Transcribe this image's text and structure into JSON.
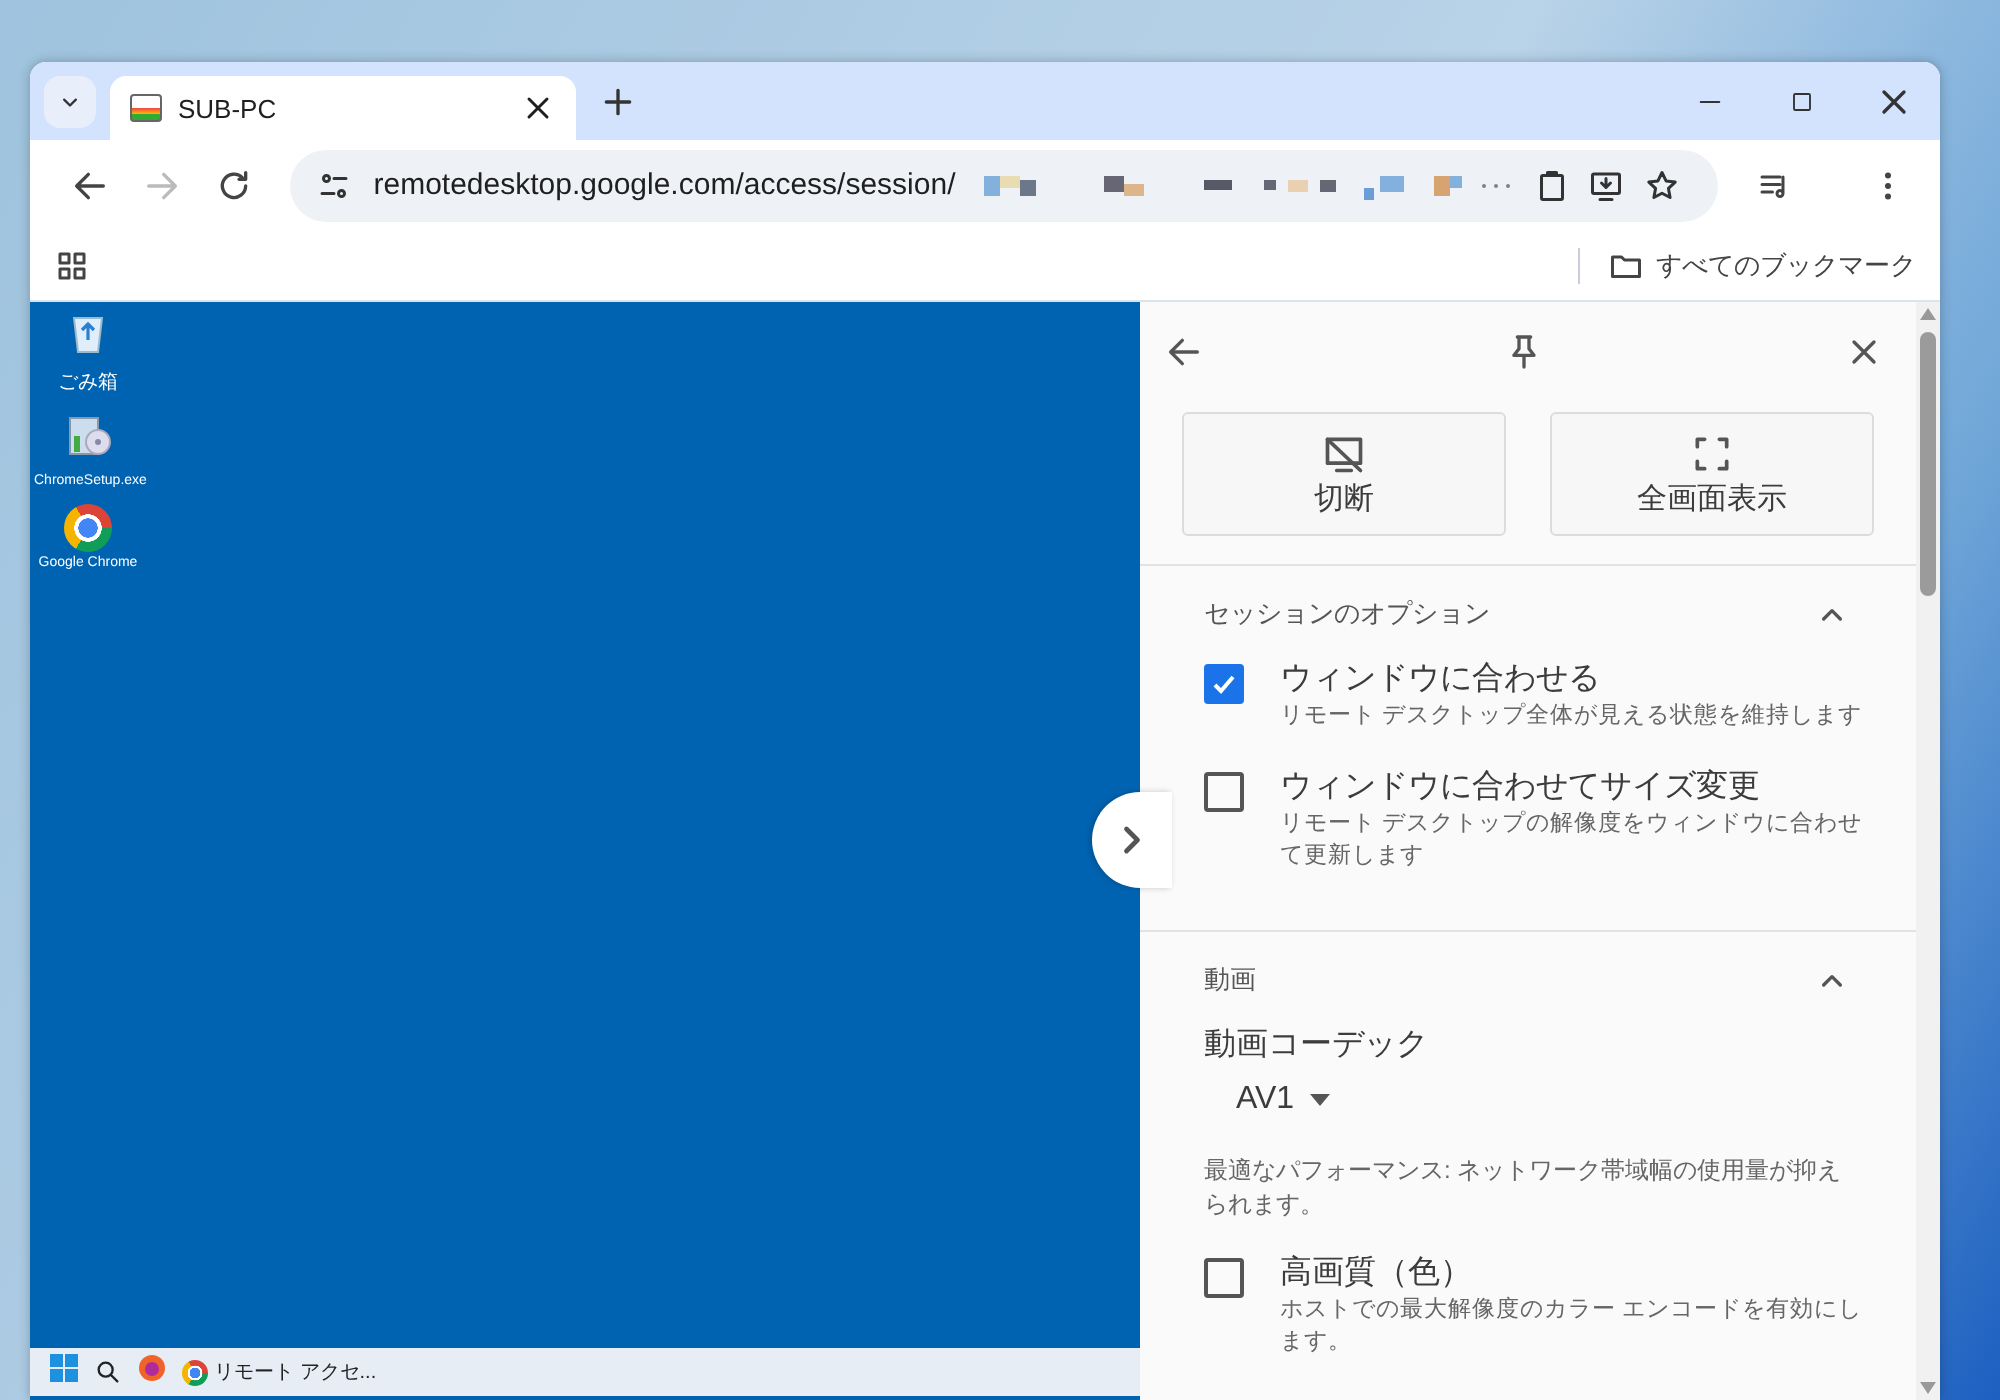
{
  "tab_strip": {
    "tab": {
      "title": "SUB-PC",
      "selected": true
    }
  },
  "address_bar": {
    "url": "remotedesktop.google.com/access/session/"
  },
  "bookmarks_bar": {
    "all_bookmarks": "すべてのブックマーク"
  },
  "remote_desktop": {
    "icons": [
      {
        "label": "ごみ箱",
        "kind": "recycle"
      },
      {
        "label": "ChromeSetup.exe",
        "kind": "setup"
      },
      {
        "label": "Google Chrome",
        "kind": "chrome"
      }
    ],
    "taskbar": {
      "app_label": "リモート アクセ..."
    }
  },
  "side_panel": {
    "buttons": [
      {
        "label": "切断",
        "kind": "disconnect"
      },
      {
        "label": "全画面表示",
        "kind": "fullscreen"
      }
    ],
    "sections": [
      {
        "title": "セッションのオプション",
        "expanded": true,
        "items": [
          {
            "kind": "checkbox",
            "label": "ウィンドウに合わせる",
            "description": "リモート デスクトップ全体が見える状態を維持します",
            "checked": true
          },
          {
            "kind": "checkbox",
            "label": "ウィンドウに合わせてサイズ変更",
            "description": "リモート デスクトップの解像度をウィンドウに合わせて更新します",
            "checked": false
          }
        ]
      },
      {
        "title": "動画",
        "expanded": true,
        "items": [
          {
            "kind": "select",
            "label": "動画コーデック",
            "value": "AV1",
            "description": "最適なパフォーマンス: ネットワーク帯域幅の使用量が抑えられます。"
          },
          {
            "kind": "checkbox",
            "label": "高画質（色）",
            "description": "ホストでの最大解像度のカラー エンコードを有効にします。",
            "checked": false
          }
        ]
      }
    ]
  }
}
